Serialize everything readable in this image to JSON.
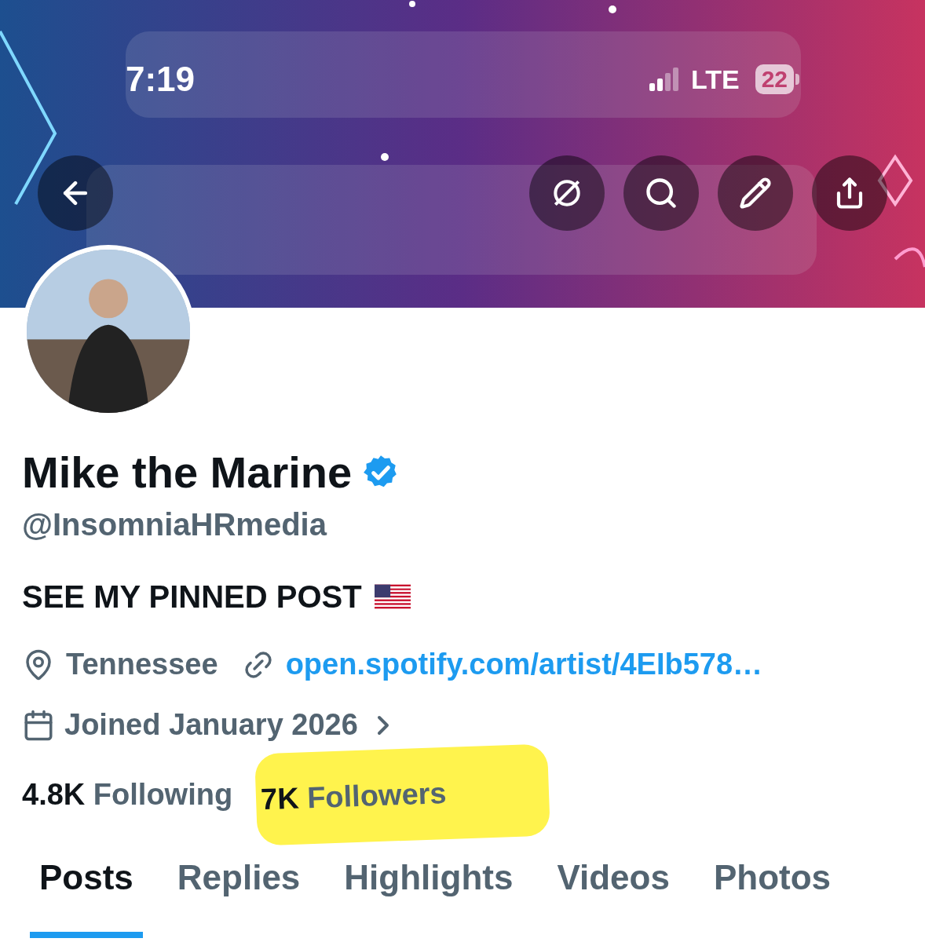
{
  "status_bar": {
    "time": "7:19",
    "network": "LTE",
    "battery": "22"
  },
  "profile": {
    "name": "Mike the Marine",
    "verified": true,
    "handle": "@InsomniaHRmedia",
    "bio": "SEE MY PINNED POST",
    "bio_flag": true,
    "location": "Tennessee",
    "link": "open.spotify.com/artist/4EIb578…",
    "joined": "Joined January 2026"
  },
  "stats": [
    {
      "count": "4.8K",
      "label": "Following",
      "highlighted": false
    },
    {
      "count": "7K",
      "label": "Followers",
      "highlighted": true
    }
  ],
  "tabs": [
    {
      "label": "Posts",
      "selected": true
    },
    {
      "label": "Replies",
      "selected": false
    },
    {
      "label": "Highlights",
      "selected": false
    },
    {
      "label": "Videos",
      "selected": false
    },
    {
      "label": "Photos",
      "selected": false
    }
  ]
}
